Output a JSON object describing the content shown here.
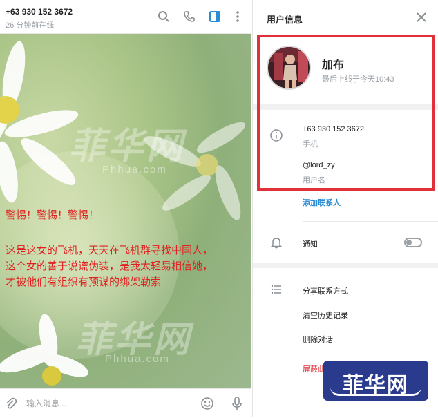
{
  "chat": {
    "peer_phone": "+63 930 152 3672",
    "peer_status": "26 分钟前在线",
    "watermark_cn": "菲华网",
    "watermark_en": "Phhua.com",
    "warning_line1": "警惕！警惕！警惕！",
    "warning_line2": "这是这女的飞机，天天在飞机群寻找中国人，",
    "warning_line3": "这个女的善于说谎伪装，是我太轻易相信她，",
    "warning_line4": "才被他们有组织有预谋的绑架勒索",
    "composer_placeholder": "输入消息..."
  },
  "info": {
    "title": "用户信息",
    "name": "加布",
    "last_seen": "最后上线于今天10:43",
    "phone": "+63 930 152 3672",
    "phone_label": "手机",
    "username": "@lord_zy",
    "username_label": "用户名",
    "add_contact": "添加联系人",
    "notifications": "通知",
    "share_contact": "分享联系方式",
    "clear_history": "清空历史记录",
    "delete_chat": "删除对话",
    "block_user": "屏蔽此"
  },
  "badge": {
    "text": "菲华网"
  },
  "colors": {
    "accent": "#2a8bd6",
    "highlight": "#e0313a",
    "warning": "#e02020",
    "badge": "#2a3a8c"
  }
}
